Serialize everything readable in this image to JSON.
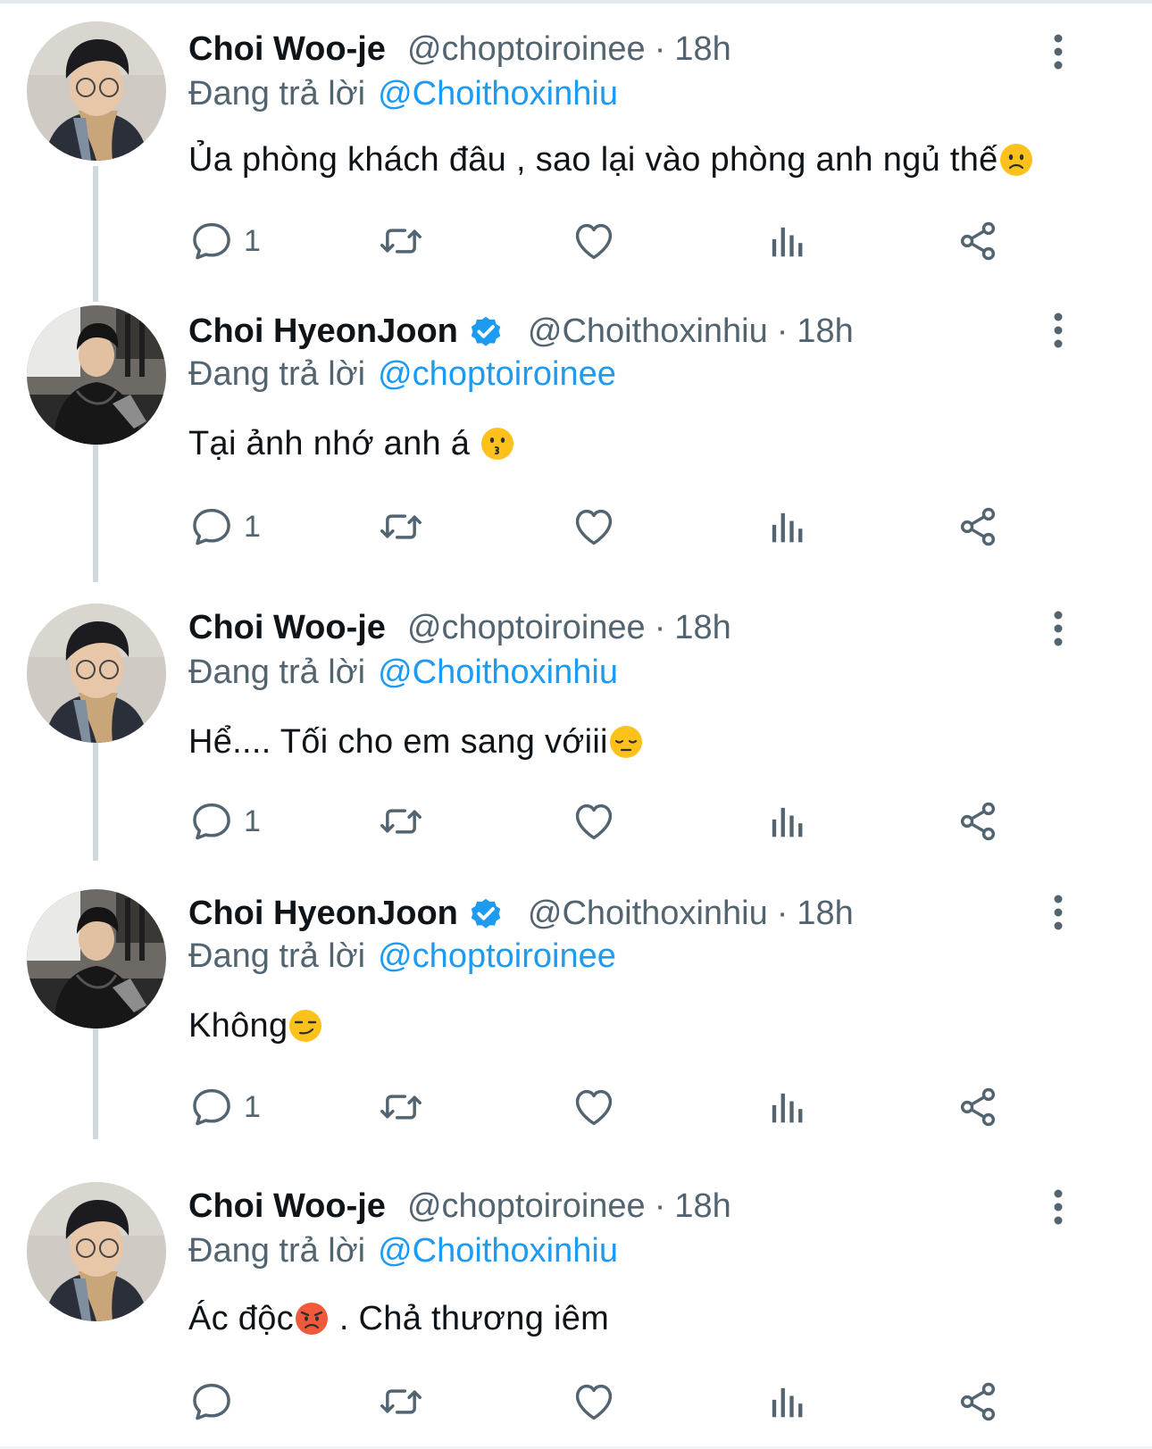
{
  "reply_prefix": "Đang trả lời",
  "tweets": [
    {
      "author": "Choi Woo-je",
      "handle": "@choptoiroinee",
      "dot": "·",
      "time": "18h",
      "reply_to": "@Choithoxinhiu",
      "text": "Ủa phòng khách đâu , sao lại vào phòng anh ngủ thế",
      "reply_count": "1",
      "verified": false
    },
    {
      "author": "Choi HyeonJoon",
      "handle": "@Choithoxinhiu",
      "dot": "·",
      "time": "18h",
      "reply_to": "@choptoiroinee",
      "text": "Tại ảnh nhớ anh á",
      "reply_count": "1",
      "verified": true
    },
    {
      "author": "Choi Woo-je",
      "handle": "@choptoiroinee",
      "dot": "·",
      "time": "18h",
      "reply_to": "@Choithoxinhiu",
      "text": "Hể.... Tối cho em sang vớiii",
      "reply_count": "1",
      "verified": false
    },
    {
      "author": "Choi HyeonJoon",
      "handle": "@Choithoxinhiu",
      "dot": "·",
      "time": "18h",
      "reply_to": "@choptoiroinee",
      "text": "Không",
      "reply_count": "1",
      "verified": true
    },
    {
      "author": "Choi Woo-je",
      "handle": "@choptoiroinee",
      "dot": "·",
      "time": "18h",
      "reply_to": "@Choithoxinhiu",
      "text_a": "Ác độc",
      "text_b": " . Chả thương iêm",
      "reply_count": "",
      "verified": false
    }
  ],
  "colors": {
    "link": "#1d9bf0",
    "secondary": "#536471",
    "thread_line": "#cfd9de"
  }
}
